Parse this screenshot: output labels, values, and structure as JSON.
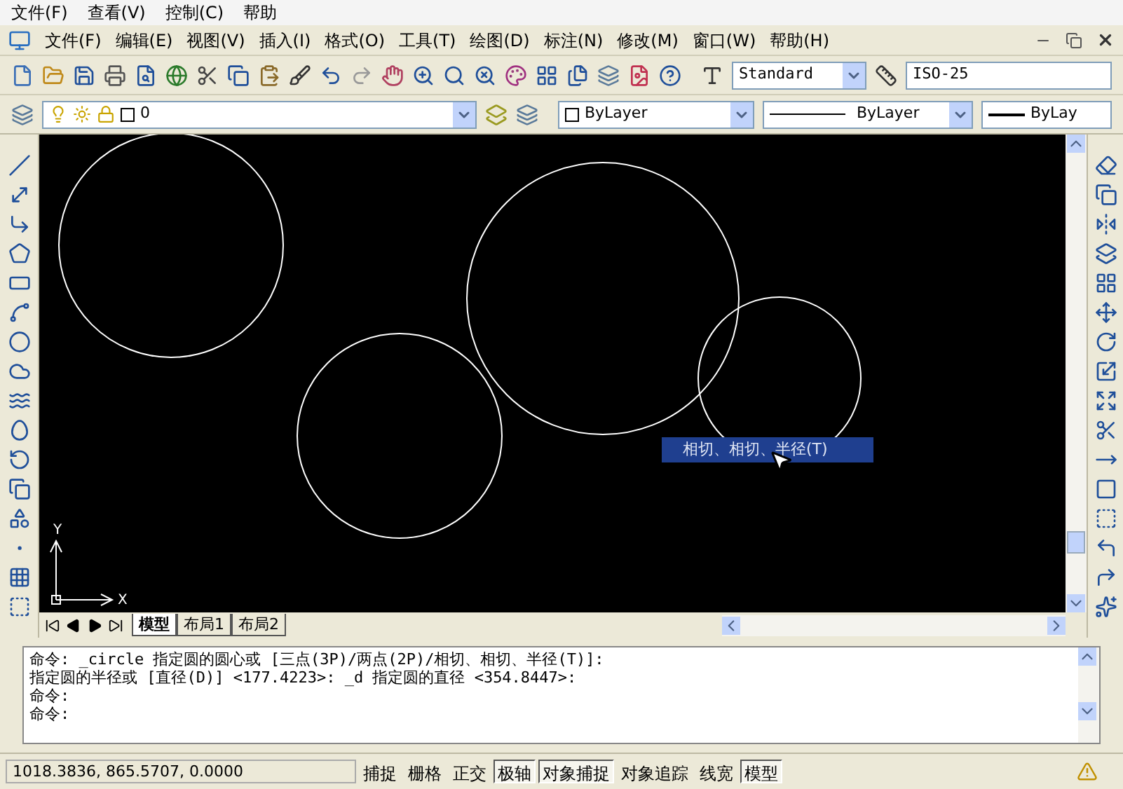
{
  "system_menu": [
    "文件(F)",
    "查看(V)",
    "控制(C)",
    "帮助"
  ],
  "app_menu": [
    "文件(F)",
    "编辑(E)",
    "视图(V)",
    "插入(I)",
    "格式(O)",
    "工具(T)",
    "绘图(D)",
    "标注(N)",
    "修改(M)",
    "窗口(W)",
    "帮助(H)"
  ],
  "text_style": {
    "value": "Standard"
  },
  "dim_style": {
    "value": "ISO-25"
  },
  "layer": {
    "value": "0"
  },
  "color": {
    "value": "ByLayer"
  },
  "linetype": {
    "value": "ByLayer"
  },
  "lineweight": {
    "value": "ByLay"
  },
  "ucs": {
    "y_label": "Y",
    "x_label": "X"
  },
  "tooltip": "相切、相切、半径(T)",
  "tabs": [
    {
      "label": "模型",
      "selected": true
    },
    {
      "label": "布局1",
      "selected": false
    },
    {
      "label": "布局2",
      "selected": false
    }
  ],
  "command_lines": [
    "命令: _circle 指定圆的圆心或 [三点(3P)/两点(2P)/相切、相切、半径(T)]:",
    "指定圆的半径或 [直径(D)] <177.4223>: _d 指定圆的直径 <354.8447>:",
    "命令:",
    "命令:"
  ],
  "coordinates": "1018.3836, 865.5707, 0.0000",
  "toggles": [
    {
      "label": "捕捉",
      "on": false
    },
    {
      "label": "栅格",
      "on": false
    },
    {
      "label": "正交",
      "on": false
    },
    {
      "label": "极轴",
      "on": true
    },
    {
      "label": "对象捕捉",
      "on": true
    },
    {
      "label": "对象追踪",
      "on": false
    },
    {
      "label": "线宽",
      "on": false
    },
    {
      "label": "模型",
      "on": true
    }
  ]
}
